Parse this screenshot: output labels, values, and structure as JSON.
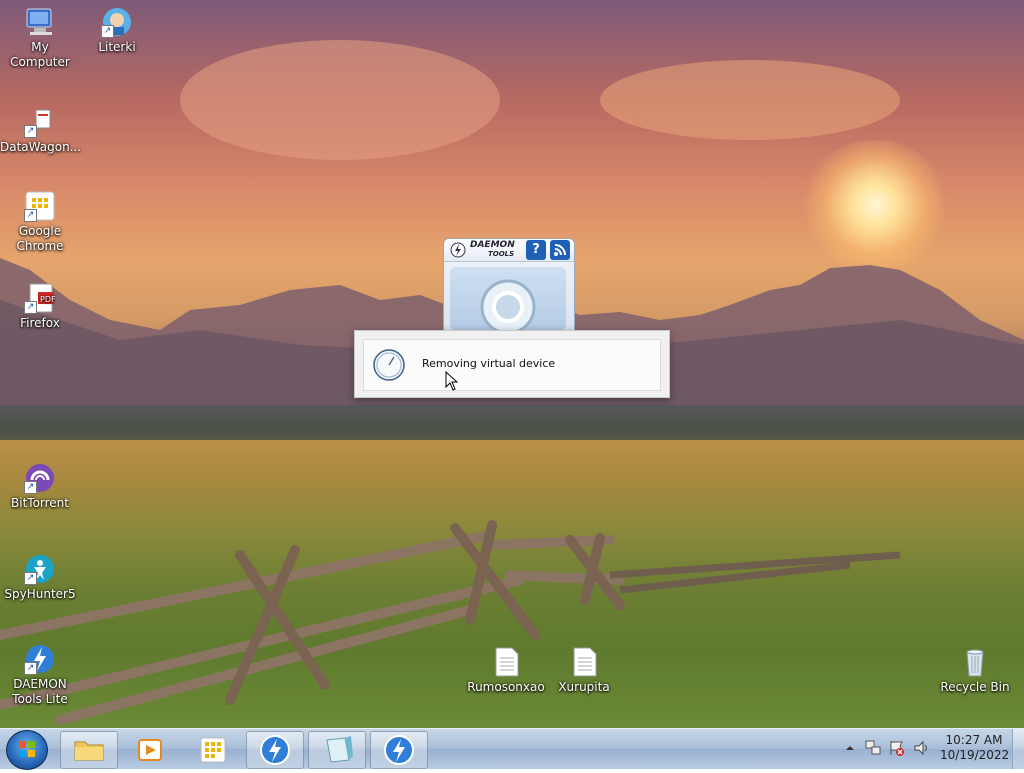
{
  "desktop_icons": {
    "my_computer": "My Computer",
    "literki": "Literki",
    "datawagon": "DataWagon...",
    "google_chrome": "Google\nChrome",
    "firefox": "Firefox",
    "bittorrent": "BitTorrent",
    "spyhunter": "SpyHunter5",
    "daemon_tools": "DAEMON\nTools Lite",
    "rumosonxao": "Rumosonxao",
    "xurupita": "Xurupita",
    "recycle_bin": "Recycle Bin"
  },
  "gadget": {
    "title_line1": "DAEMON",
    "title_line2": "TOOLS",
    "help": "?"
  },
  "progress": {
    "message": "Removing virtual device"
  },
  "tray": {
    "time": "10:27 AM",
    "date": "10/19/2022"
  },
  "colors": {
    "taskbar": "#a9bfd8",
    "daemon_blue": "#1f5fb8"
  }
}
